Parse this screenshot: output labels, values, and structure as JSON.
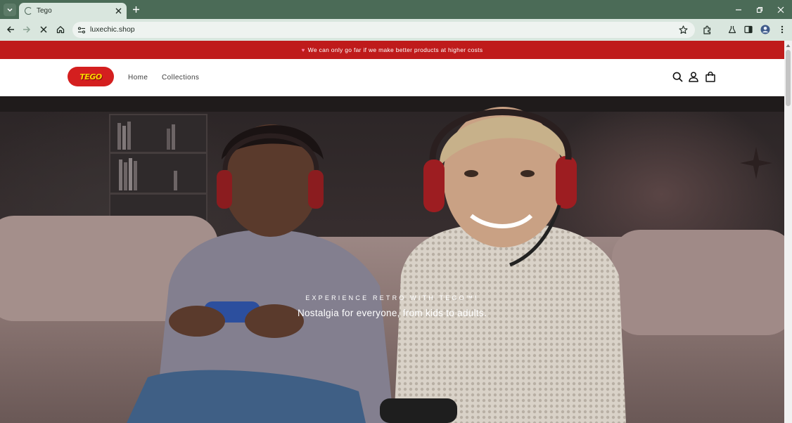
{
  "browser": {
    "tab_title": "Tego",
    "url": "luxechic.shop"
  },
  "announcement": {
    "text": "We can only go far if we make better products at higher costs"
  },
  "header": {
    "logo_text": "TEGO",
    "nav": [
      {
        "label": "Home"
      },
      {
        "label": "Collections"
      }
    ]
  },
  "hero": {
    "eyebrow": "EXPERIENCE RETRO WITH TEGO™!",
    "subtitle": "Nostalgia for everyone, from kids to adults."
  },
  "colors": {
    "announcement_bg": "#bf1b1b",
    "logo_bg": "#d41f1f",
    "logo_text": "#ffd400",
    "browser_frame": "#4b6b57"
  },
  "icons": [
    "chevron-down-icon",
    "loading-spinner-icon",
    "close-icon",
    "plus-icon",
    "minimize-icon",
    "restore-icon",
    "back-icon",
    "forward-icon",
    "stop-icon",
    "home-icon",
    "site-info-icon",
    "star-icon",
    "extensions-icon",
    "labs-icon",
    "side-panel-icon",
    "profile-icon",
    "kebab-menu-icon",
    "heart-icon",
    "search-icon",
    "account-icon",
    "cart-icon"
  ]
}
